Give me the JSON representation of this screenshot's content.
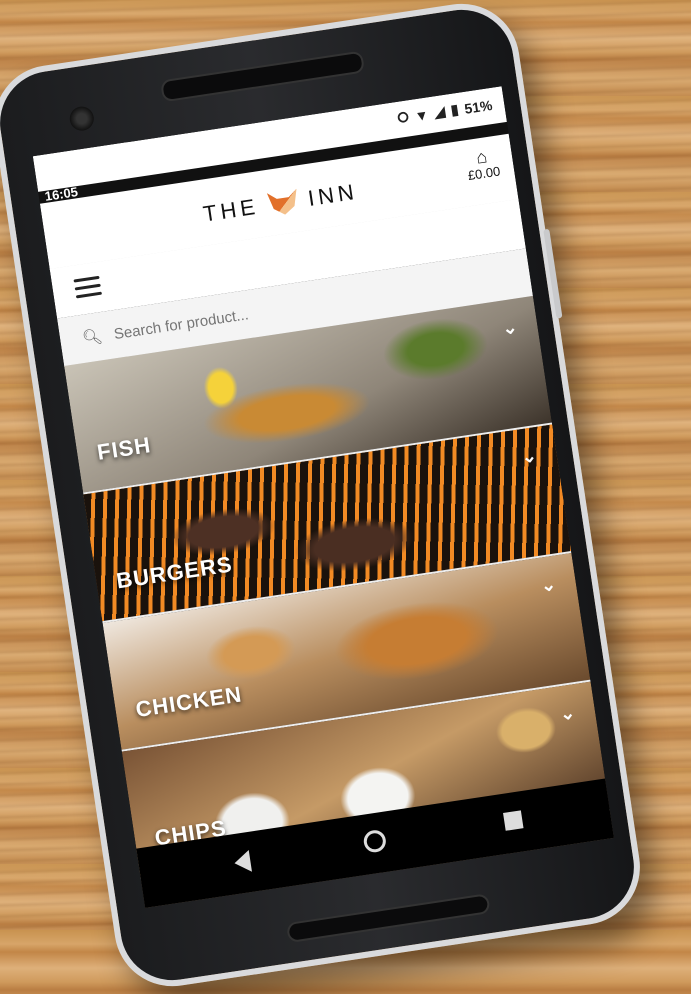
{
  "status_bar": {
    "time": "16:05",
    "battery": "51%",
    "icons": [
      "vibrate-icon",
      "wifi-icon",
      "signal-icon",
      "battery-icon"
    ]
  },
  "header": {
    "brand_left": "THE",
    "brand_right": "INN",
    "logo": "fox-logo-icon",
    "cart_total": "£0.00"
  },
  "search": {
    "placeholder": "Search for product..."
  },
  "categories": [
    {
      "label": "FISH"
    },
    {
      "label": "BURGERS"
    },
    {
      "label": "CHICKEN"
    },
    {
      "label": "CHIPS"
    },
    {
      "label": ""
    }
  ],
  "colors": {
    "header_bg": "#ffffff",
    "label_text": "#ffffff",
    "wood": "#c8924f"
  }
}
